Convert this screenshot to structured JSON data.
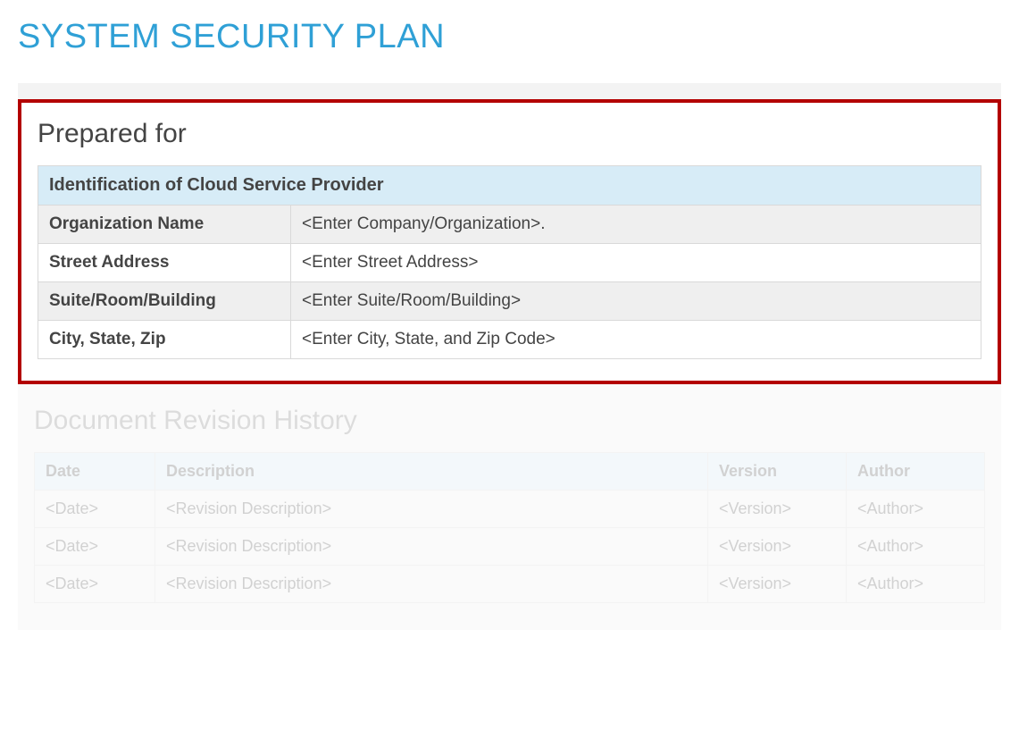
{
  "title": "SYSTEM SECURITY PLAN",
  "preparedFor": {
    "heading": "Prepared for",
    "tableTitle": "Identification of Cloud Service Provider",
    "rows": [
      {
        "label": "Organization Name",
        "value": "<Enter Company/Organization>."
      },
      {
        "label": "Street Address",
        "value": "<Enter Street Address>"
      },
      {
        "label": "Suite/Room/Building",
        "value": "<Enter Suite/Room/Building>"
      },
      {
        "label": "City, State, Zip",
        "value": "<Enter City, State, and Zip Code>"
      }
    ]
  },
  "revisionHistory": {
    "heading": "Document Revision History",
    "columns": [
      "Date",
      "Description",
      "Version",
      "Author"
    ],
    "rows": [
      {
        "date": "<Date>",
        "description": "<Revision Description>",
        "version": "<Version>",
        "author": "<Author>"
      },
      {
        "date": "<Date>",
        "description": "<Revision Description>",
        "version": "<Version>",
        "author": "<Author>"
      },
      {
        "date": "<Date>",
        "description": "<Revision Description>",
        "version": "<Version>",
        "author": "<Author>"
      }
    ]
  }
}
